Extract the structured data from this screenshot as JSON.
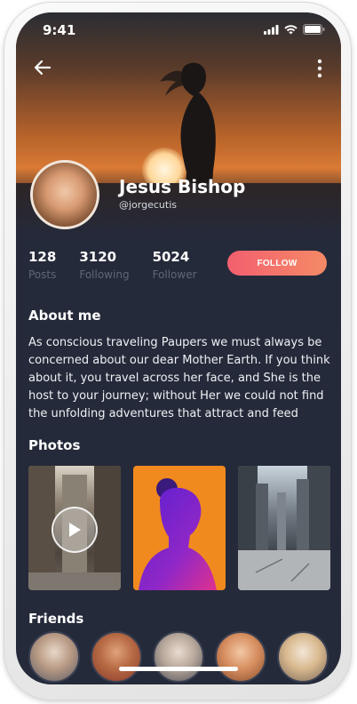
{
  "status": {
    "time": "9:41"
  },
  "profile": {
    "name": "Jesus Bishop",
    "handle": "@jorgecutis",
    "stats": [
      {
        "value": "128",
        "label": "Posts"
      },
      {
        "value": "3120",
        "label": "Following"
      },
      {
        "value": "5024",
        "label": "Follower"
      }
    ],
    "follow_label": "FOLLOW"
  },
  "about": {
    "title": "About me",
    "text": "As conscious traveling Paupers we must always be concerned about our dear Mother Earth. If you think about it, you travel across her face, and She is the host to your journey; without Her we could not find the unfolding adventures that attract and feed"
  },
  "photos": {
    "title": "Photos"
  },
  "friends": {
    "title": "Friends"
  },
  "colors": {
    "background": "#252a3a",
    "accent_start": "#f35f6f",
    "accent_end": "#f48a66",
    "muted_text": "#5f6679"
  },
  "icons": [
    "back-arrow-icon",
    "more-vertical-icon",
    "signal-icon",
    "wifi-icon",
    "battery-icon",
    "play-icon"
  ]
}
